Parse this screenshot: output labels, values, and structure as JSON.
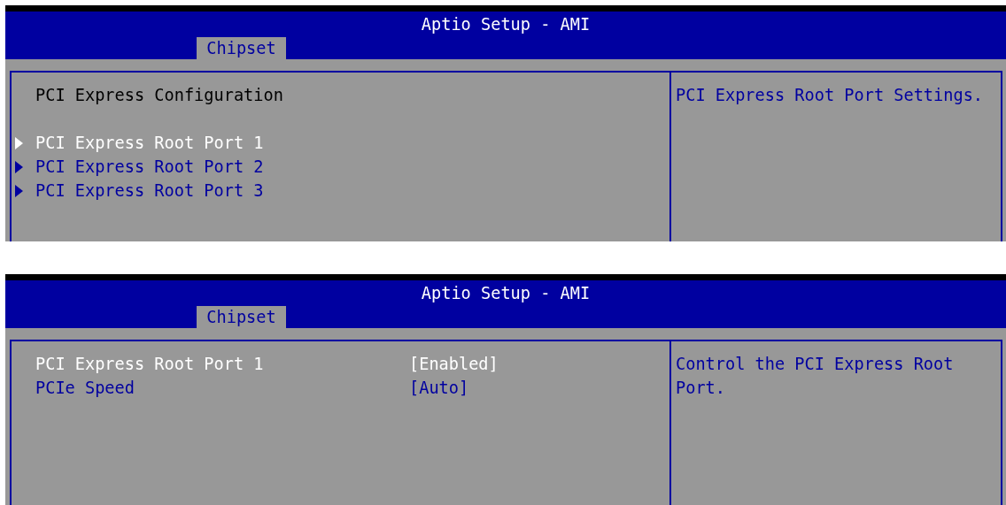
{
  "screens": [
    {
      "title": "Aptio Setup - AMI",
      "tabs": [
        {
          "label": "Chipset",
          "selected": true
        }
      ],
      "items": [
        {
          "kind": "label",
          "label": "PCI Express Configuration",
          "selected": false
        },
        {
          "kind": "submenu",
          "label": "PCI Express Root Port 1",
          "selected": true
        },
        {
          "kind": "submenu",
          "label": "PCI Express Root Port 2",
          "selected": false
        },
        {
          "kind": "submenu",
          "label": "PCI Express Root Port 3",
          "selected": false
        }
      ],
      "help": "PCI Express Root Port Settings."
    },
    {
      "title": "Aptio Setup - AMI",
      "tabs": [
        {
          "label": "Chipset",
          "selected": true
        }
      ],
      "items": [
        {
          "kind": "setting",
          "label": "PCI Express Root Port 1",
          "value": "[Enabled]",
          "selected": true
        },
        {
          "kind": "setting",
          "label": "PCIe Speed",
          "value": "[Auto]",
          "selected": false
        }
      ],
      "help": "Control the PCI Express Root Port."
    }
  ]
}
